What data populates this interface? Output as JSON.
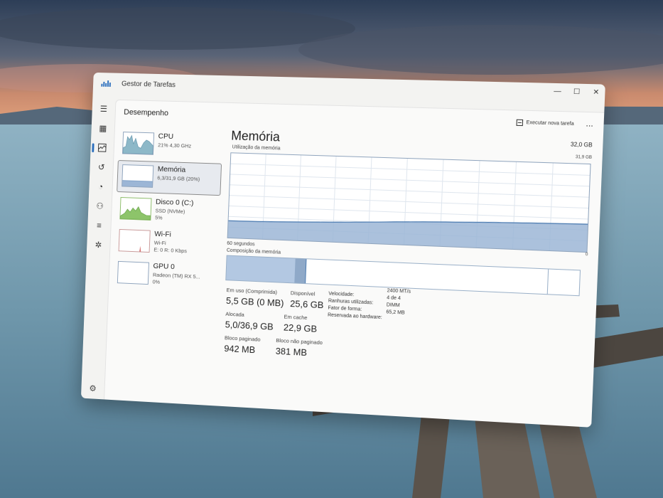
{
  "window": {
    "title": "Gestor de Tarefas"
  },
  "header": {
    "title": "Desempenho",
    "run_task": "Executar nova tarefa",
    "more": "..."
  },
  "nav_icons": [
    "hamburger-icon",
    "processes-icon",
    "performance-icon",
    "history-icon",
    "startup-icon",
    "users-icon",
    "details-icon",
    "services-icon"
  ],
  "devices": [
    {
      "name": "CPU",
      "sub1": "21% 4,30 GHz",
      "sub2": "",
      "sub3": ""
    },
    {
      "name": "Memória",
      "sub1": "6,3/31,9 GB (20%)",
      "sub2": "",
      "sub3": ""
    },
    {
      "name": "Disco 0 (C:)",
      "sub1": "SSD (NVMe)",
      "sub2": "5%",
      "sub3": ""
    },
    {
      "name": "Wi-Fi",
      "sub1": "Wi-Fi",
      "sub2": "E: 0 R: 0 Kbps",
      "sub3": ""
    },
    {
      "name": "GPU 0",
      "sub1": "Radeon (TM) RX 5...",
      "sub2": "0%",
      "sub3": ""
    }
  ],
  "memory": {
    "title": "Memória",
    "total": "32,0 GB",
    "usage_label": "Utilização da memória",
    "usage_max": "31,9 GB",
    "usage_min": "0",
    "time_label": "60 segundos",
    "composition_label": "Composição da memória",
    "composition": {
      "in_use_fraction": 0.2,
      "modified_fraction": 0.03
    },
    "stats": {
      "in_use_label": "Em uso (Comprimida)",
      "in_use": "5,5 GB (0 MB)",
      "available_label": "Disponível",
      "available": "25,6 GB",
      "committed_label": "Alocada",
      "committed": "5,0/36,9 GB",
      "cached_label": "Em cache",
      "cached": "22,9 GB",
      "paged_label": "Bloco paginado",
      "paged": "942 MB",
      "nonpaged_label": "Bloco não paginado",
      "nonpaged": "381 MB"
    },
    "specs": [
      {
        "label": "Velocidade:",
        "value": "2400 MT/s"
      },
      {
        "label": "Ranhuras utilizadas:",
        "value": "4 de 4"
      },
      {
        "label": "Fator de forma:",
        "value": "DIMM"
      },
      {
        "label": "Reservada ao hardware:",
        "value": "65,2 MB"
      }
    ]
  },
  "colors": {
    "accent": "#2a6ebd",
    "mem_fill": "#9cb6d6",
    "mem_line": "#4a7ab0",
    "disk_fill": "#8dc46a",
    "cpu_fill": "#8db8c8"
  }
}
